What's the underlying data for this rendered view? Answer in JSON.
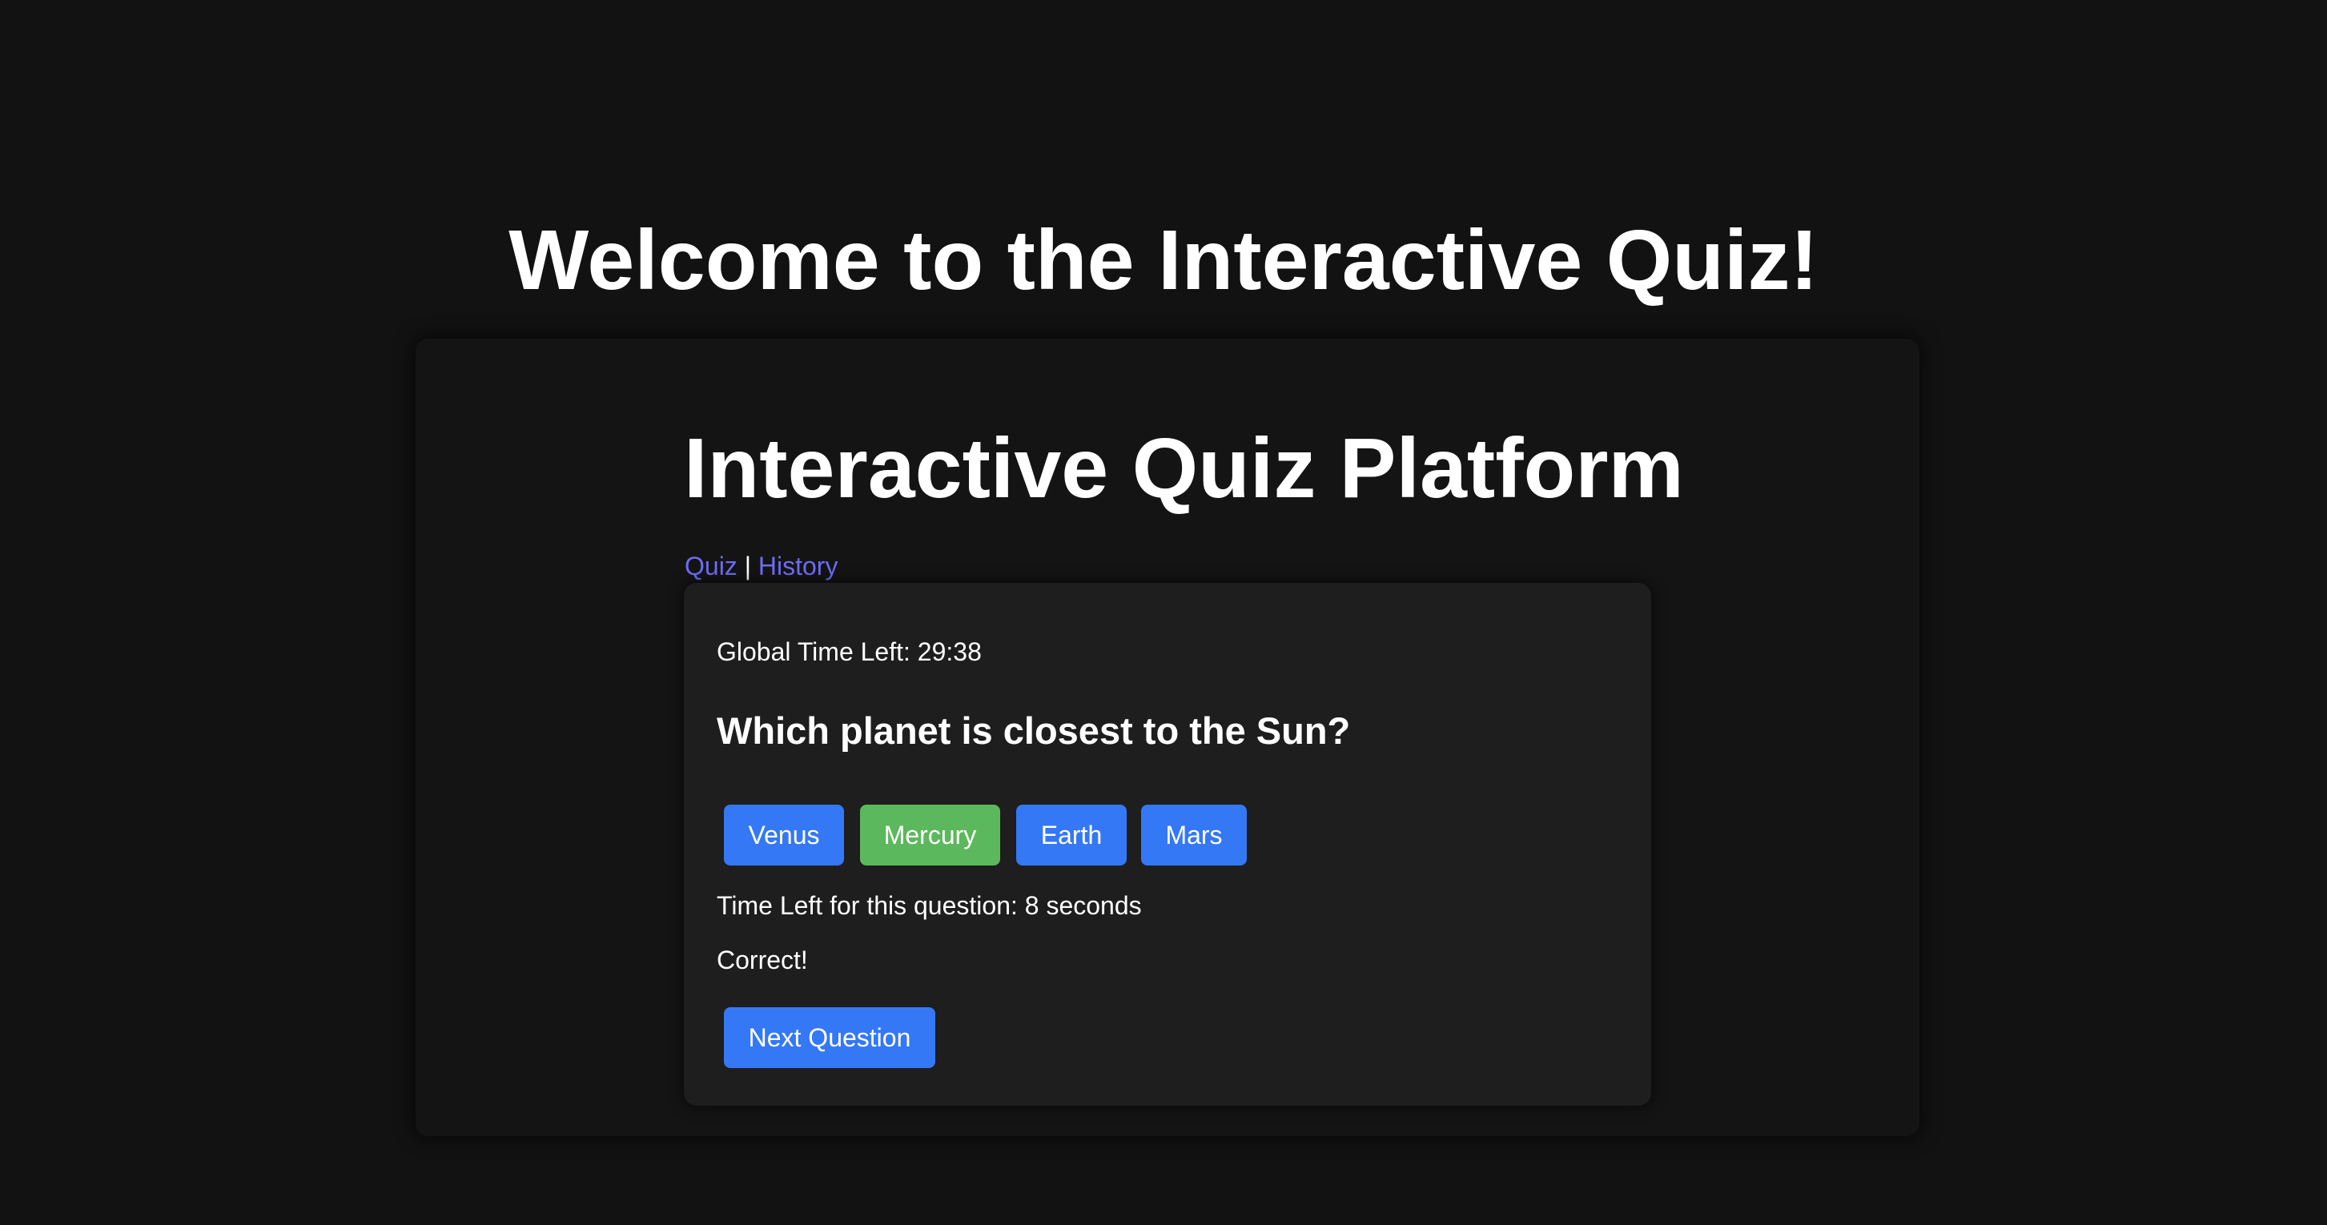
{
  "page": {
    "title": "Welcome to the Interactive Quiz!"
  },
  "app": {
    "title": "Interactive Quiz Platform",
    "nav": {
      "quiz_label": "Quiz",
      "separator": "|",
      "history_label": "History"
    }
  },
  "quiz": {
    "global_timer_text": "Global Time Left: 29:38",
    "question": "Which planet is closest to the Sun?",
    "options": [
      {
        "label": "Venus",
        "state": "default"
      },
      {
        "label": "Mercury",
        "state": "correct"
      },
      {
        "label": "Earth",
        "state": "default"
      },
      {
        "label": "Mars",
        "state": "default"
      }
    ],
    "question_timer_text": "Time Left for this question: 8 seconds",
    "feedback": "Correct!",
    "next_button_label": "Next Question"
  },
  "colors": {
    "background": "#121212",
    "panel": "#1e1e1e",
    "link": "#6f6cf5",
    "button": "#3478f6",
    "correct": "#5cb85c"
  }
}
